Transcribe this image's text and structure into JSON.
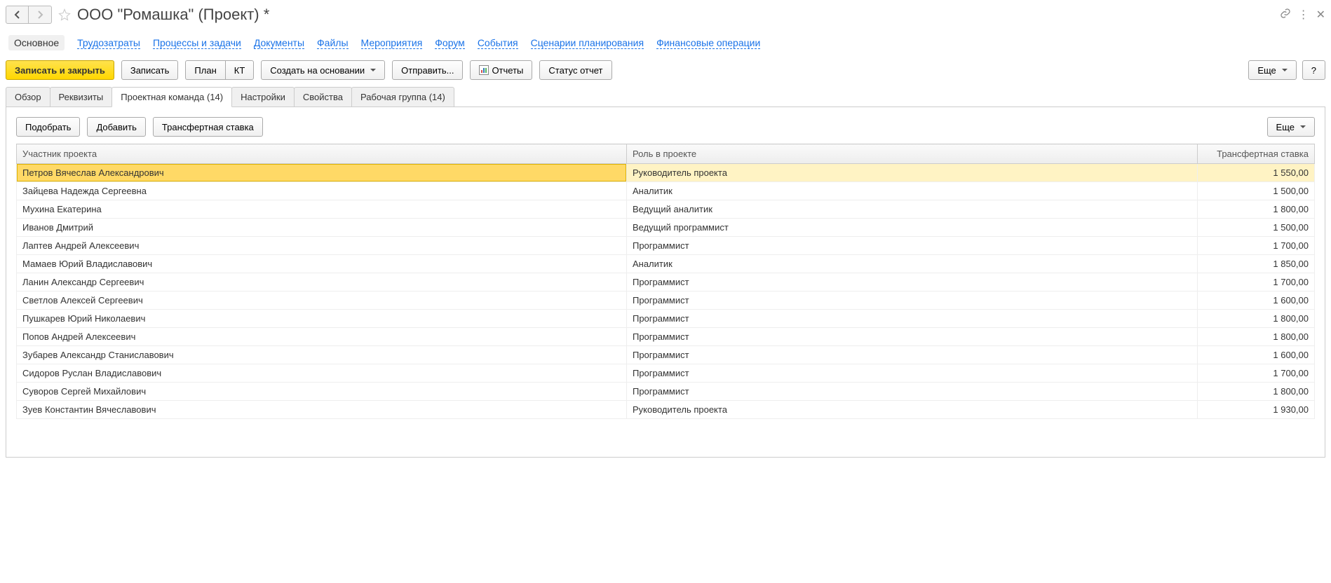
{
  "header": {
    "title": "ООО \"Ромашка\" (Проект) *"
  },
  "link_tabs": {
    "active": "Основное",
    "items": [
      "Трудозатраты",
      "Процессы и задачи",
      "Документы",
      "Файлы",
      "Мероприятия",
      "Форум",
      "События",
      "Сценарии планирования",
      "Финансовые операции"
    ]
  },
  "toolbar": {
    "save_close": "Записать и закрыть",
    "save": "Записать",
    "plan": "План",
    "kt": "КТ",
    "create_based": "Создать на основании",
    "send": "Отправить...",
    "reports": "Отчеты",
    "status_report": "Статус отчет",
    "more": "Еще",
    "help": "?"
  },
  "sub_tabs": [
    "Обзор",
    "Реквизиты",
    "Проектная команда (14)",
    "Настройки",
    "Свойства",
    "Рабочая группа (14)"
  ],
  "sub_tab_active_index": 2,
  "inner_toolbar": {
    "pick": "Подобрать",
    "add": "Добавить",
    "transfer_rate": "Трансфертная ставка",
    "more": "Еще"
  },
  "table": {
    "columns": {
      "participant": "Участник проекта",
      "role": "Роль в проекте",
      "rate": "Трансфертная ставка"
    },
    "rows": [
      {
        "participant": "Петров Вячеслав Александрович",
        "role": "Руководитель проекта",
        "rate": "1 550,00",
        "selected": true
      },
      {
        "participant": "Зайцева Надежда Сергеевна",
        "role": "Аналитик",
        "rate": "1 500,00"
      },
      {
        "participant": "Мухина Екатерина",
        "role": "Ведущий аналитик",
        "rate": "1 800,00"
      },
      {
        "participant": "Иванов Дмитрий",
        "role": "Ведущий программист",
        "rate": "1 500,00"
      },
      {
        "participant": "Лаптев Андрей Алексеевич",
        "role": "Программист",
        "rate": "1 700,00"
      },
      {
        "participant": "Мамаев Юрий Владиславович",
        "role": "Аналитик",
        "rate": "1 850,00"
      },
      {
        "participant": "Ланин Александр Сергеевич",
        "role": "Программист",
        "rate": "1 700,00"
      },
      {
        "participant": "Светлов Алексей Сергеевич",
        "role": "Программист",
        "rate": "1 600,00"
      },
      {
        "participant": "Пушкарев Юрий Николаевич",
        "role": "Программист",
        "rate": "1 800,00"
      },
      {
        "participant": "Попов Андрей Алексеевич",
        "role": "Программист",
        "rate": "1 800,00"
      },
      {
        "participant": "Зубарев Александр Станиславович",
        "role": "Программист",
        "rate": "1 600,00"
      },
      {
        "participant": "Сидоров Руслан Владиславович",
        "role": "Программист",
        "rate": "1 700,00"
      },
      {
        "participant": "Суворов Сергей Михайлович",
        "role": "Программист",
        "rate": "1 800,00"
      },
      {
        "participant": "Зуев Константин Вячеславович",
        "role": "Руководитель проекта",
        "rate": "1 930,00"
      }
    ]
  }
}
